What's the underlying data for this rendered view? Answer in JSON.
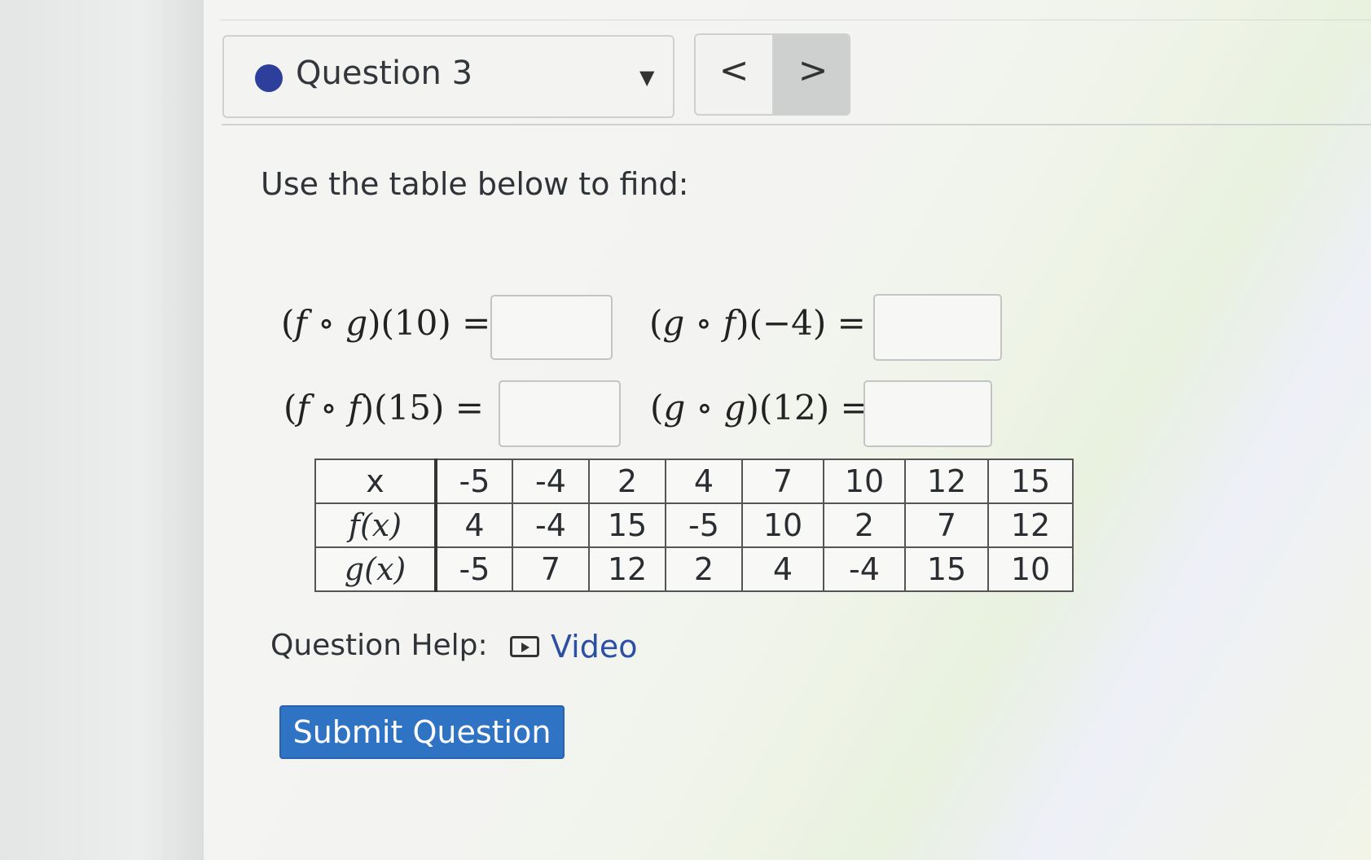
{
  "header": {
    "question_label": "Question 3",
    "prev_label": "<",
    "next_label": ">"
  },
  "instruction": "Use the table below to find:",
  "expressions": [
    {
      "outer": "f",
      "inner": "g",
      "arg": "10",
      "suffix": "=",
      "answer": ""
    },
    {
      "outer": "g",
      "inner": "f",
      "arg": "−4",
      "suffix": "=",
      "answer": ""
    },
    {
      "outer": "f",
      "inner": "f",
      "arg": "15",
      "suffix": "=",
      "answer": ""
    },
    {
      "outer": "g",
      "inner": "g",
      "arg": "12",
      "suffix": "=",
      "answer": ""
    }
  ],
  "table": {
    "header_label": "x",
    "x_values": [
      "-5",
      "-4",
      "2",
      "4",
      "7",
      "10",
      "12",
      "15"
    ],
    "rows": [
      {
        "label": "f(x)",
        "values": [
          "4",
          "-4",
          "15",
          "-5",
          "10",
          "2",
          "7",
          "12"
        ]
      },
      {
        "label": "g(x)",
        "values": [
          "-5",
          "7",
          "12",
          "2",
          "4",
          "-4",
          "15",
          "10"
        ]
      }
    ]
  },
  "help": {
    "label": "Question Help:",
    "video_label": "Video",
    "video_icon": "video-play-icon"
  },
  "submit_label": "Submit Question",
  "colors": {
    "accent": "#2f73c4",
    "link": "#2b4fa3",
    "status_dot": "#2d3f9a"
  }
}
